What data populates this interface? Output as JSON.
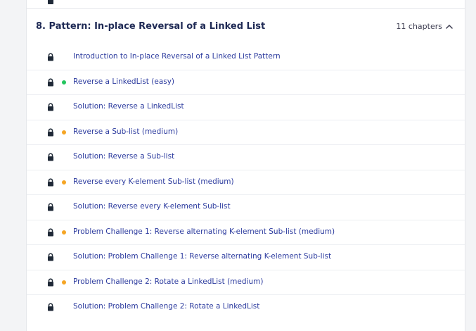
{
  "colors": {
    "easy": "#22c55e",
    "medium": "#f5a524",
    "link": "#2b3a9e",
    "title": "#1f2a55"
  },
  "section": {
    "title": "8.  Pattern: In-place Reversal of a Linked List",
    "chapter_count": "11 chapters",
    "expanded_icon": "chevron-up-icon"
  },
  "lessons": [
    {
      "label": "Introduction to In-place Reversal of a Linked List Pattern",
      "locked": true,
      "difficulty": null
    },
    {
      "label": "Reverse a LinkedList (easy)",
      "locked": true,
      "difficulty": "easy"
    },
    {
      "label": "Solution: Reverse a LinkedList",
      "locked": true,
      "difficulty": null
    },
    {
      "label": "Reverse a Sub-list (medium)",
      "locked": true,
      "difficulty": "medium"
    },
    {
      "label": "Solution: Reverse a Sub-list",
      "locked": true,
      "difficulty": null
    },
    {
      "label": "Reverse every K-element Sub-list (medium)",
      "locked": true,
      "difficulty": "medium"
    },
    {
      "label": "Solution: Reverse every K-element Sub-list",
      "locked": true,
      "difficulty": null
    },
    {
      "label": "Problem Challenge 1: Reverse alternating K-element Sub-list (medium)",
      "locked": true,
      "difficulty": "medium"
    },
    {
      "label": "Solution: Problem Challenge 1: Reverse alternating K-element Sub-list",
      "locked": true,
      "difficulty": null
    },
    {
      "label": "Problem Challenge 2: Rotate a LinkedList (medium)",
      "locked": true,
      "difficulty": "medium"
    },
    {
      "label": "Solution: Problem Challenge 2: Rotate a LinkedList",
      "locked": true,
      "difficulty": null
    }
  ]
}
